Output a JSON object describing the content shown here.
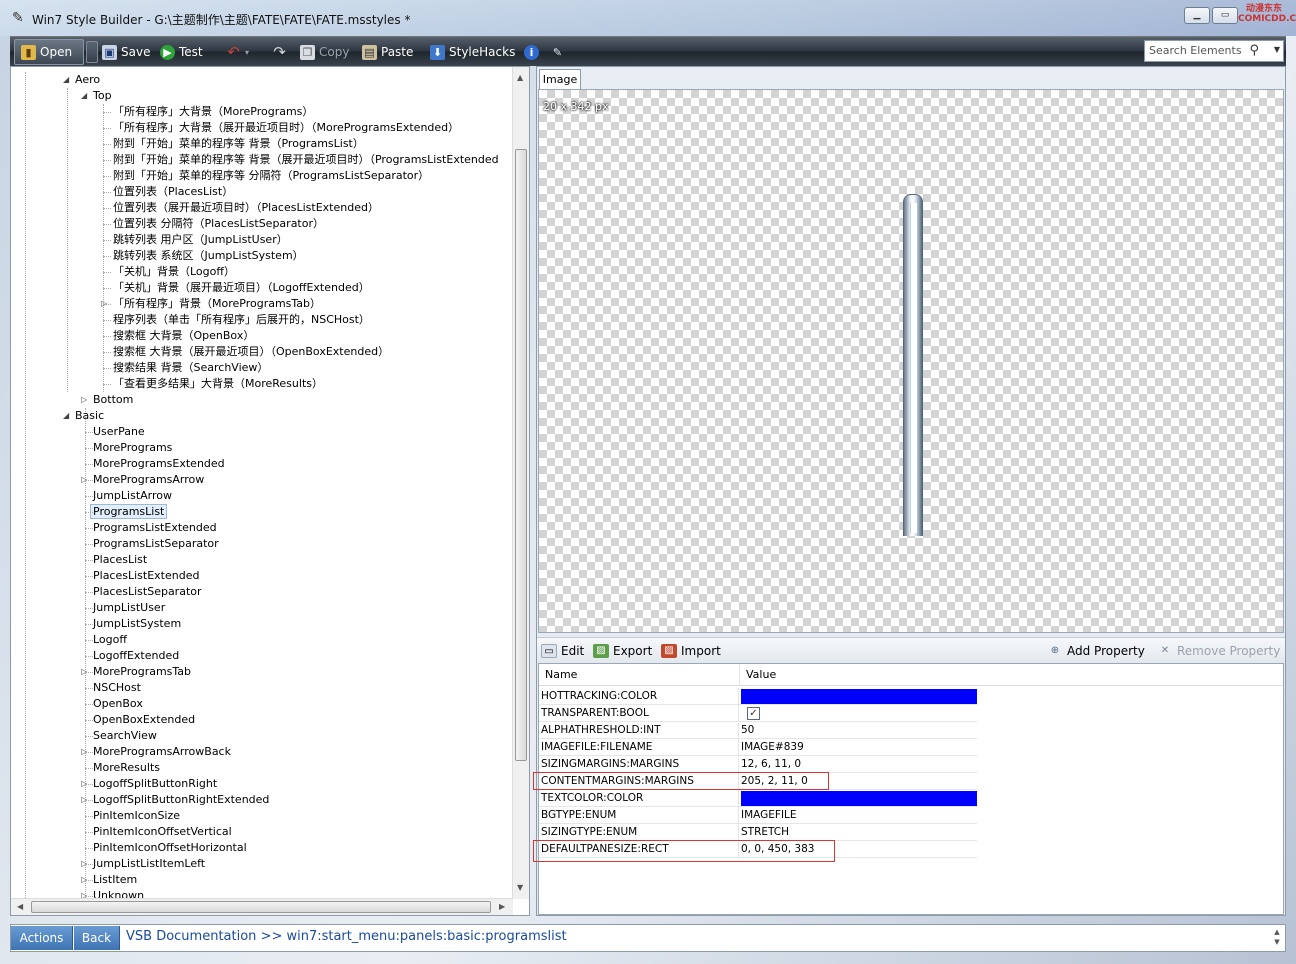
{
  "window": {
    "title": "Win7 Style Builder - G:\\主题制作\\主题\\FATE\\FATE\\FATE.msstyles *",
    "watermark": "动漫东东 COMICDD.COM"
  },
  "toolbar": {
    "open": "Open",
    "save": "Save",
    "test": "Test",
    "copy": "Copy",
    "paste": "Paste",
    "stylehacks": "StyleHacks",
    "search_placeholder": "Search Elements"
  },
  "tree": {
    "aero": "Aero",
    "top": "Top",
    "top_items": [
      "「所有程序」大背景（MorePrograms）",
      "「所有程序」大背景（展开最近项目时）（MoreProgramsExtended）",
      "附到「开始」菜单的程序等 背景（ProgramsList）",
      "附到「开始」菜单的程序等 背景（展开最近项目时）（ProgramsListExtended",
      "附到「开始」菜单的程序等 分隔符（ProgramsListSeparator）",
      "位置列表（PlacesList）",
      "位置列表（展开最近项目时）（PlacesListExtended）",
      "位置列表 分隔符（PlacesListSeparator）",
      "跳转列表 用户区（JumpListUser）",
      "跳转列表 系统区（JumpListSystem）",
      "「关机」背景（Logoff）",
      "「关机」背景（展开最近项目）（LogoffExtended）",
      "「所有程序」背景（MoreProgramsTab）",
      "程序列表（单击「所有程序」后展开的，NSCHost）",
      "搜索框 大背景（OpenBox）",
      "搜索框 大背景（展开最近项目）（OpenBoxExtended）",
      "搜索结果 背景（SearchView）",
      "「查看更多结果」大背景（MoreResults）"
    ],
    "bottom": "Bottom",
    "basic": "Basic",
    "basic_items": [
      "UserPane",
      "MorePrograms",
      "MoreProgramsExtended",
      "MoreProgramsArrow",
      "JumpListArrow",
      "ProgramsList",
      "ProgramsListExtended",
      "ProgramsListSeparator",
      "PlacesList",
      "PlacesListExtended",
      "PlacesListSeparator",
      "JumpListUser",
      "JumpListSystem",
      "Logoff",
      "LogoffExtended",
      "MoreProgramsTab",
      "NSCHost",
      "OpenBox",
      "OpenBoxExtended",
      "SearchView",
      "MoreProgramsArrowBack",
      "MoreResults",
      "LogoffSplitButtonRight",
      "LogoffSplitButtonRightExtended",
      "PinItemIconSize",
      "PinItemIconOffsetVertical",
      "PinItemIconOffsetHorizontal",
      "JumpListListItemLeft",
      "ListItem",
      "Unknown"
    ]
  },
  "preview": {
    "tab": "Image",
    "dimensions": "20 x 342 px"
  },
  "actions": {
    "edit": "Edit",
    "export": "Export",
    "import": "Import",
    "add_property": "Add Property",
    "remove_property": "Remove Property"
  },
  "properties": {
    "header_name": "Name",
    "header_value": "Value",
    "rows": [
      {
        "name": "HOTTRACKING:COLOR",
        "value": ""
      },
      {
        "name": "TRANSPARENT:BOOL",
        "value": ""
      },
      {
        "name": "ALPHATHRESHOLD:INT",
        "value": "50"
      },
      {
        "name": "IMAGEFILE:FILENAME",
        "value": "IMAGE#839"
      },
      {
        "name": "SIZINGMARGINS:MARGINS",
        "value": "12, 6, 11, 0"
      },
      {
        "name": "CONTENTMARGINS:MARGINS",
        "value": "205, 2, 11, 0"
      },
      {
        "name": "TEXTCOLOR:COLOR",
        "value": ""
      },
      {
        "name": "BGTYPE:ENUM",
        "value": "IMAGEFILE"
      },
      {
        "name": "SIZINGTYPE:ENUM",
        "value": "STRETCH"
      },
      {
        "name": "DEFAULTPANESIZE:RECT",
        "value": "0, 0, 450, 383"
      }
    ],
    "color_swatch": "#0000ff"
  },
  "statusbar": {
    "actions": "Actions",
    "back": "Back",
    "text": "VSB Documentation >> win7:start_menu:panels:basic:programslist"
  }
}
